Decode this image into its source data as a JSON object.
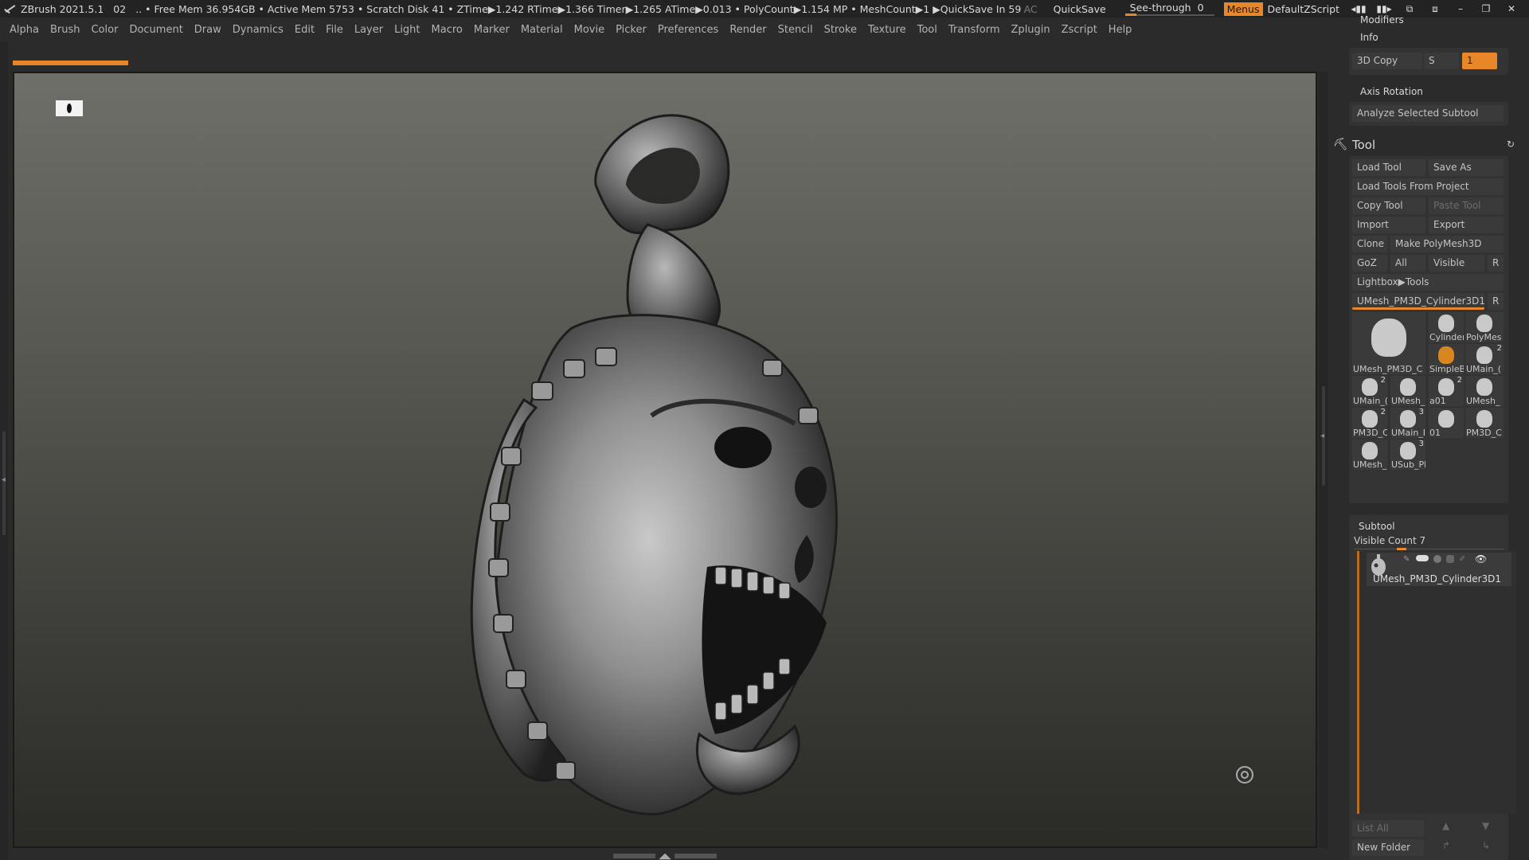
{
  "titlebar": {
    "app": "ZBrush 2021.5.1",
    "doc": "02",
    "stats": ".. • Free Mem 36.954GB • Active Mem 5753 • Scratch Disk 41 •  ZTime▶1.242 RTime▶1.366 Timer▶1.265 ATime▶0.013 • PolyCount▶1.154 MP  • MeshCount▶1  ▶QuickSave In 59 Secs",
    "ac": "AC",
    "quicksave": "QuickSave",
    "see_through_label": "See-through",
    "see_through_value": "0",
    "menus": "Menus",
    "default_zscript": "DefaultZScript"
  },
  "menubar": [
    "Alpha",
    "Brush",
    "Color",
    "Document",
    "Draw",
    "Dynamics",
    "Edit",
    "File",
    "Layer",
    "Light",
    "Macro",
    "Marker",
    "Material",
    "Movie",
    "Picker",
    "Preferences",
    "Render",
    "Stencil",
    "Stroke",
    "Texture",
    "Tool",
    "Transform",
    "Zplugin",
    "Zscript",
    "Help"
  ],
  "panel": {
    "modifiers": "Modifiers",
    "info": "Info",
    "copy3d": "3D Copy",
    "s_label": "S",
    "s_value": "1",
    "axis_rotation": "Axis Rotation",
    "analyze": "Analyze Selected Subtool",
    "tool_title": "Tool",
    "load_tool": "Load Tool",
    "save_as": "Save As",
    "load_from_project": "Load Tools From Project",
    "copy_tool": "Copy Tool",
    "paste_tool": "Paste Tool",
    "import": "Import",
    "export": "Export",
    "clone": "Clone",
    "make_polymesh": "Make PolyMesh3D",
    "goz": "GoZ",
    "all": "All",
    "visible": "Visible",
    "r": "R",
    "lightbox_tools": "Lightbox▶Tools",
    "current_tool": "UMesh_PM3D_Cylinder3D1",
    "subtool_title": "Subtool",
    "visible_count": "Visible Count 7",
    "subtool_name": "UMesh_PM3D_Cylinder3D1",
    "list_all": "List All",
    "new_folder": "New Folder"
  },
  "tool_thumbs": [
    {
      "label": "UMesh_PM3D_C",
      "num": ""
    },
    {
      "label": "Cylinder",
      "num": ""
    },
    {
      "label": "PolyMes",
      "num": ""
    },
    {
      "label": "SimpleB",
      "num": ""
    },
    {
      "label": "UMain_(",
      "num": "2"
    },
    {
      "label": "UMain_(",
      "num": "2"
    },
    {
      "label": "UMesh_",
      "num": ""
    },
    {
      "label": "a01",
      "num": "2"
    },
    {
      "label": "UMesh_",
      "num": ""
    },
    {
      "label": "PM3D_C",
      "num": "2"
    },
    {
      "label": "UMain_I",
      "num": "3"
    },
    {
      "label": "01",
      "num": ""
    },
    {
      "label": "PM3D_C",
      "num": ""
    },
    {
      "label": "UMesh_",
      "num": ""
    },
    {
      "label": "USub_Pl",
      "num": "3"
    }
  ],
  "colors": {
    "accent": "#e8862a",
    "panel_bg": "#2b2b2b",
    "button_bg": "#3a3a3a"
  }
}
